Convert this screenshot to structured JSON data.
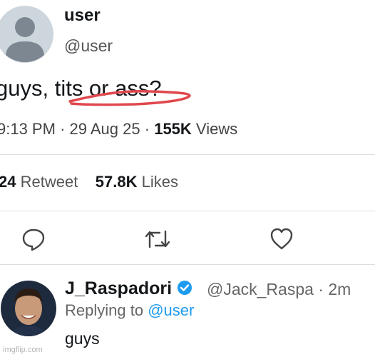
{
  "tweet": {
    "username": "user",
    "handle": "@user",
    "text": "guys, tits or ass?",
    "time": "9:13 PM",
    "date": "29 Aug 25",
    "views_count": "155K",
    "views_label": "Views",
    "retweets_count": "24",
    "retweets_label": "Retweet",
    "likes_count": "57.8K",
    "likes_label": "Likes"
  },
  "reply": {
    "name": "J_Raspadori",
    "handle": "@Jack_Raspa",
    "time": "2m",
    "replying_prefix": "Replying to",
    "replying_to": "@user",
    "text": "guys"
  },
  "watermark": "imgflip.com",
  "colors": {
    "accent": "#1d9bf0",
    "scribble": "#e0474c",
    "divider": "#dedede"
  },
  "icons": [
    "reply-icon",
    "retweet-icon",
    "like-icon",
    "verified-icon"
  ]
}
